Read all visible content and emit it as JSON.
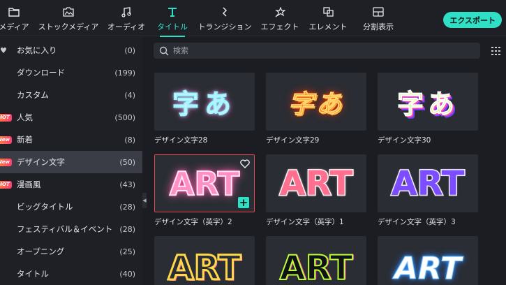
{
  "toolbar": {
    "tabs": [
      {
        "label": "メディア",
        "icon": "folder-icon"
      },
      {
        "label": "ストックメディア",
        "icon": "stock-image-icon"
      },
      {
        "label": "オーディオ",
        "icon": "music-note-icon"
      },
      {
        "label": "タイトル",
        "icon": "title-t-icon"
      },
      {
        "label": "トランジション",
        "icon": "transition-icon"
      },
      {
        "label": "エフェクト",
        "icon": "effect-star-icon"
      },
      {
        "label": "エレメント",
        "icon": "element-layers-icon"
      },
      {
        "label": "分割表示",
        "icon": "split-screen-icon"
      }
    ],
    "active_tab": "タイトル",
    "export_label": "エクスポート"
  },
  "sidebar": {
    "items": [
      {
        "label": "お気に入り",
        "count": "(0)",
        "icon": "heart-icon"
      },
      {
        "label": "ダウンロード",
        "count": "(199)"
      },
      {
        "label": "カスタム",
        "count": "(4)"
      },
      {
        "label": "人気",
        "count": "(500)",
        "badge": "HOT"
      },
      {
        "label": "新着",
        "count": "(8)",
        "badge": "New"
      },
      {
        "label": "デザイン文字",
        "count": "(50)",
        "badge": "New",
        "selected": true
      },
      {
        "label": "漫画風",
        "count": "(43)",
        "badge": "HOT"
      },
      {
        "label": "ビッグタイトル",
        "count": "(28)"
      },
      {
        "label": "フェスティバル＆イベント",
        "count": "(28)"
      },
      {
        "label": "オープニング",
        "count": "(25)"
      },
      {
        "label": "タイトル",
        "count": "(40)"
      }
    ]
  },
  "search": {
    "placeholder": "検索"
  },
  "cards": [
    {
      "caption": "デザイン文字28",
      "text": "字あ",
      "style": "neon-outline"
    },
    {
      "caption": "デザイン文字29",
      "text": "字あ",
      "style": "fire"
    },
    {
      "caption": "デザイン文字30",
      "text": "字あ",
      "style": "rainbow"
    },
    {
      "caption": "デザイン文字（英字）2",
      "text": "ART",
      "style": "pink-glow",
      "selected": true
    },
    {
      "caption": "デザイン文字（英字）1",
      "text": "ART",
      "style": "pink-white"
    },
    {
      "caption": "デザイン文字（英字）3",
      "text": "ART",
      "style": "purple-white"
    },
    {
      "caption": "",
      "text": "ART",
      "style": "yellow-outline"
    },
    {
      "caption": "",
      "text": "ART",
      "style": "black-green"
    },
    {
      "caption": "",
      "text": "ART",
      "style": "blue-neon"
    }
  ],
  "colors": {
    "accent": "#2fe0c6",
    "selection": "#e5484d",
    "badge_gradient": [
      "#ff8a3c",
      "#ff3d6e"
    ]
  }
}
